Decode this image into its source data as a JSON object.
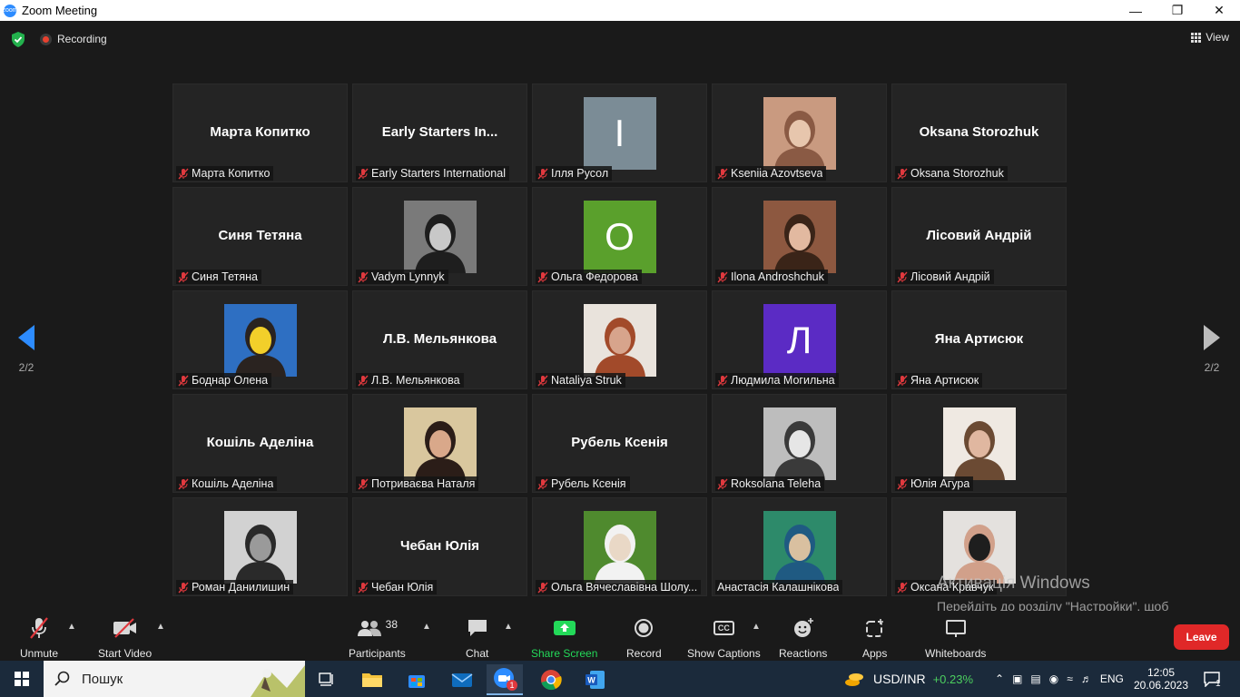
{
  "window": {
    "title": "Zoom Meeting",
    "app_icon_text": "zoom"
  },
  "top_bar": {
    "recording_label": "Recording",
    "view_label": "View"
  },
  "pager": {
    "left_label": "2/2",
    "right_label": "2/2"
  },
  "participants": [
    {
      "display": "Марта Копитко",
      "label": "Марта Копитко",
      "kind": "name"
    },
    {
      "display": "Early Starters In...",
      "label": "Early Starters International",
      "kind": "name"
    },
    {
      "display": "І",
      "label": "Ілля Русол",
      "kind": "letter",
      "color": "#7b8c96"
    },
    {
      "display": "",
      "label": "Kseniia Azovtseva",
      "kind": "photo",
      "photo": [
        "#c99a80",
        "#e7c6ad",
        "#8a5a44"
      ]
    },
    {
      "display": "Oksana Storozhuk",
      "label": "Oksana Storozhuk",
      "kind": "name"
    },
    {
      "display": "Синя Тетяна",
      "label": "Синя Тетяна",
      "kind": "name"
    },
    {
      "display": "",
      "label": "Vadym Lynnyk",
      "kind": "photo",
      "photo": [
        "#7a7a7a",
        "#c8c8c8",
        "#1e1e1e"
      ]
    },
    {
      "display": "О",
      "label": "Ольга Федорова",
      "kind": "letter",
      "color": "#5aa02c"
    },
    {
      "display": "",
      "label": "Ilona Androshchuk",
      "kind": "photo",
      "photo": [
        "#8d5840",
        "#e2b9a0",
        "#3a2418"
      ]
    },
    {
      "display": "Лісовий Андрій",
      "label": "Лісовий Андрій",
      "kind": "name"
    },
    {
      "display": "",
      "label": "Боднар Олена",
      "kind": "photo",
      "photo": [
        "#2e6fc2",
        "#f2cf2a",
        "#2a2320"
      ]
    },
    {
      "display": "Л.В. Мельянкова",
      "label": "Л.В. Мельянкова",
      "kind": "name"
    },
    {
      "display": "",
      "label": "Nataliya Struk",
      "kind": "photo",
      "photo": [
        "#e9e3dc",
        "#d7a48c",
        "#a24a2a"
      ]
    },
    {
      "display": "Л",
      "label": "Людмила Могильна",
      "kind": "letter",
      "color": "#5b2bc4"
    },
    {
      "display": "Яна Артисюк",
      "label": "Яна Артисюк",
      "kind": "name"
    },
    {
      "display": "Кошіль Аделіна",
      "label": "Кошіль Аделіна",
      "kind": "name"
    },
    {
      "display": "",
      "label": "Потриваєва Наталя",
      "kind": "photo",
      "photo": [
        "#d9c79e",
        "#d9a88a",
        "#2b1d18"
      ]
    },
    {
      "display": "Рубель Ксенія",
      "label": "Рубель Ксенія",
      "kind": "name"
    },
    {
      "display": "",
      "label": "Roksolana Teleha",
      "kind": "photo",
      "photo": [
        "#bdbdbd",
        "#e6e6e6",
        "#3a3a3a"
      ]
    },
    {
      "display": "",
      "label": "Юлія Агура",
      "kind": "photo",
      "photo": [
        "#efe9e2",
        "#e0b7a0",
        "#6b4a33"
      ]
    },
    {
      "display": "",
      "label": "Роман Данилишин",
      "kind": "photo",
      "photo": [
        "#d2d2d2",
        "#9a9a9a",
        "#2a2a2a"
      ]
    },
    {
      "display": "Чебан Юлія",
      "label": "Чебан Юлія",
      "kind": "name"
    },
    {
      "display": "",
      "label": "Ольга Вячеславівна Шолу...",
      "kind": "photo",
      "photo": [
        "#4f8a2e",
        "#e9d8c6",
        "#f2f2f2"
      ]
    },
    {
      "display": "",
      "label": "Анастасія Калашнікова",
      "kind": "photo",
      "photo": [
        "#2d8a6a",
        "#d9c0a0",
        "#1f5a82"
      ],
      "no_mic": true
    },
    {
      "display": "",
      "label": "Оксана Кравчук",
      "kind": "photo",
      "photo": [
        "#e4e1de",
        "#1e1e1e",
        "#d1a08a"
      ]
    }
  ],
  "toolbar": {
    "unmute": "Unmute",
    "start_video": "Start Video",
    "participants": "Participants",
    "participants_count": "38",
    "chat": "Chat",
    "share_screen": "Share Screen",
    "record": "Record",
    "show_captions": "Show Captions",
    "cc_badge": "CC",
    "reactions": "Reactions",
    "apps": "Apps",
    "whiteboards": "Whiteboards",
    "leave": "Leave"
  },
  "activation": {
    "title": "Активація Windows",
    "body": "Перейдіть до розділу \"Настройки\", щоб активувати Windows."
  },
  "taskbar": {
    "search_placeholder": "Пошук",
    "currency": "USD/INR",
    "currency_change": "+0.23%",
    "language": "ENG",
    "time": "12:05",
    "date": "20.06.2023",
    "notification_count": "1",
    "zoom_badge": "1"
  },
  "colors": {
    "accent": "#2d8cff",
    "leave": "#e02828",
    "share": "#23d959",
    "mic_off": "#e0393e"
  }
}
